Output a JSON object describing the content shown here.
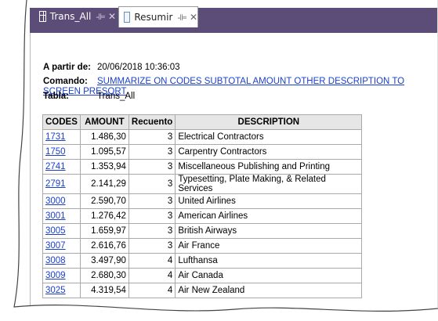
{
  "tabs": [
    {
      "label": "Trans_All",
      "icon": "table-icon"
    },
    {
      "label": "Resumir",
      "icon": "document-icon"
    }
  ],
  "info": {
    "date_label": "A partir de:",
    "date_value": "20/06/2018 10:36:03",
    "command_label": "Comando:",
    "command_value": "SUMMARIZE ON CODES SUBTOTAL AMOUNT OTHER DESCRIPTION TO SCREEN PRESORT",
    "table_label": "Tabla:",
    "table_value": "Trans_All"
  },
  "table": {
    "headers": [
      "CODES",
      "AMOUNT",
      "Recuento",
      "DESCRIPTION"
    ],
    "rows": [
      {
        "code": "1731",
        "amount": "1.486,30",
        "count": "3",
        "description": "Electrical Contractors"
      },
      {
        "code": "1750",
        "amount": "1.095,57",
        "count": "3",
        "description": "Carpentry Contractors"
      },
      {
        "code": "2741",
        "amount": "1.353,94",
        "count": "3",
        "description": "Miscellaneous Publishing and Printing"
      },
      {
        "code": "2791",
        "amount": "2.141,29",
        "count": "3",
        "description": "Typesetting, Plate Making, & Related Services"
      },
      {
        "code": "3000",
        "amount": "2.590,70",
        "count": "3",
        "description": "United Airlines"
      },
      {
        "code": "3001",
        "amount": "1.276,42",
        "count": "3",
        "description": "American Airlines"
      },
      {
        "code": "3005",
        "amount": "1.659,97",
        "count": "3",
        "description": "British Airways"
      },
      {
        "code": "3007",
        "amount": "2.616,76",
        "count": "3",
        "description": "Air France"
      },
      {
        "code": "3008",
        "amount": "3.497,90",
        "count": "4",
        "description": "Lufthansa"
      },
      {
        "code": "3009",
        "amount": "2.680,30",
        "count": "4",
        "description": "Air Canada"
      },
      {
        "code": "3025",
        "amount": "4.319,54",
        "count": "4",
        "description": "Air New Zealand"
      }
    ]
  }
}
